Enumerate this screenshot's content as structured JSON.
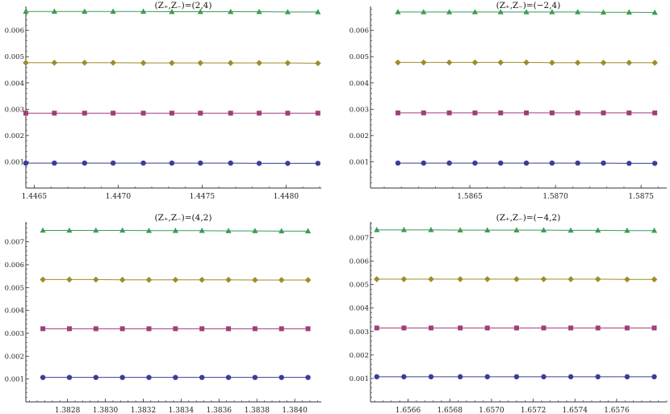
{
  "colors": {
    "series1": "#3b3d98",
    "series2": "#a03f78",
    "series3": "#9e8c2b",
    "series4": "#3a9c53",
    "axis": "#333333"
  },
  "chart_data": [
    {
      "type": "line",
      "title": "(Z₊,Z₋)=(2,4)",
      "xlim": [
        1.44645,
        1.44821
      ],
      "ylim": [
        0.0,
        0.00685
      ],
      "xticks": [
        "1.4465",
        "1.4470",
        "1.4475",
        "1.4480"
      ],
      "xtick_values": [
        1.4465,
        1.447,
        1.4475,
        1.448
      ],
      "yticks": [
        "0.001",
        "0.002",
        "0.003",
        "0.004",
        "0.005",
        "0.006"
      ],
      "ytick_values": [
        0.001,
        0.002,
        0.003,
        0.004,
        0.005,
        0.006
      ],
      "x": [
        1.44645,
        1.44662,
        1.4468,
        1.44697,
        1.44715,
        1.44732,
        1.44749,
        1.44767,
        1.44784,
        1.44801,
        1.44819
      ],
      "series": [
        {
          "marker": "circle",
          "values": [
            0.00095,
            0.00095,
            0.00095,
            0.00095,
            0.00095,
            0.00095,
            0.00095,
            0.00095,
            0.00094,
            0.00094,
            0.00094
          ]
        },
        {
          "marker": "square",
          "values": [
            0.00285,
            0.00285,
            0.00285,
            0.00285,
            0.00285,
            0.00285,
            0.00285,
            0.00285,
            0.00285,
            0.00285,
            0.00285
          ]
        },
        {
          "marker": "diamond",
          "values": [
            0.00477,
            0.00477,
            0.00477,
            0.00477,
            0.00476,
            0.00476,
            0.00476,
            0.00476,
            0.00476,
            0.00476,
            0.00475
          ]
        },
        {
          "marker": "triangle",
          "values": [
            0.00672,
            0.00672,
            0.00672,
            0.00672,
            0.00672,
            0.00671,
            0.00671,
            0.00671,
            0.00671,
            0.0067,
            0.0067
          ]
        }
      ]
    },
    {
      "type": "line",
      "title": "(Z₊,Z₋)=(−2,4)",
      "xlim": [
        1.58592,
        1.58765
      ],
      "ylim": [
        0.0,
        0.00685
      ],
      "xticks": [
        "1.5865",
        "1.5870",
        "1.5875"
      ],
      "xtick_values": [
        1.5865,
        1.587,
        1.5875
      ],
      "yticks": [
        "0.001",
        "0.002",
        "0.003",
        "0.004",
        "0.005",
        "0.006"
      ],
      "ytick_values": [
        0.001,
        0.002,
        0.003,
        0.004,
        0.005,
        0.006
      ],
      "x": [
        1.58608,
        1.58623,
        1.58638,
        1.58653,
        1.58668,
        1.58683,
        1.58698,
        1.58713,
        1.58728,
        1.58743,
        1.58758
      ],
      "series": [
        {
          "marker": "circle",
          "values": [
            0.00095,
            0.00095,
            0.00095,
            0.00095,
            0.00095,
            0.00095,
            0.00095,
            0.00095,
            0.00095,
            0.00094,
            0.00094
          ]
        },
        {
          "marker": "square",
          "values": [
            0.00286,
            0.00286,
            0.00286,
            0.00286,
            0.00286,
            0.00286,
            0.00286,
            0.00286,
            0.00286,
            0.00286,
            0.00286
          ]
        },
        {
          "marker": "diamond",
          "values": [
            0.00478,
            0.00478,
            0.00478,
            0.00478,
            0.00478,
            0.00478,
            0.00477,
            0.00477,
            0.00477,
            0.00477,
            0.00477
          ]
        },
        {
          "marker": "triangle",
          "values": [
            0.0067,
            0.0067,
            0.0067,
            0.0067,
            0.0067,
            0.0067,
            0.0067,
            0.0067,
            0.00669,
            0.00669,
            0.00668
          ]
        }
      ]
    },
    {
      "type": "line",
      "title": "(Z₊,Z₋)=(4,2)",
      "xlim": [
        1.38258,
        1.38414
      ],
      "ylim": [
        0.0,
        0.0078
      ],
      "xticks": [
        "1.3828",
        "1.3830",
        "1.3832",
        "1.3834",
        "1.3836",
        "1.3838",
        "1.3840"
      ],
      "xtick_values": [
        1.3828,
        1.383,
        1.3832,
        1.3834,
        1.3836,
        1.3838,
        1.384
      ],
      "yticks": [
        "0.001",
        "0.002",
        "0.003",
        "0.004",
        "0.005",
        "0.006",
        "0.007"
      ],
      "ytick_values": [
        0.001,
        0.002,
        0.003,
        0.004,
        0.005,
        0.006,
        0.007
      ],
      "x": [
        1.38267,
        1.38281,
        1.38295,
        1.38309,
        1.38323,
        1.38337,
        1.38351,
        1.38365,
        1.38379,
        1.38393,
        1.38407
      ],
      "series": [
        {
          "marker": "circle",
          "values": [
            0.00107,
            0.00107,
            0.00107,
            0.00107,
            0.00107,
            0.00107,
            0.00107,
            0.00107,
            0.00107,
            0.00107,
            0.00107
          ]
        },
        {
          "marker": "square",
          "values": [
            0.0032,
            0.0032,
            0.0032,
            0.0032,
            0.0032,
            0.0032,
            0.0032,
            0.0032,
            0.0032,
            0.0032,
            0.0032
          ]
        },
        {
          "marker": "diamond",
          "values": [
            0.00535,
            0.00535,
            0.00535,
            0.00534,
            0.00534,
            0.00534,
            0.00534,
            0.00534,
            0.00533,
            0.00533,
            0.00533
          ]
        },
        {
          "marker": "triangle",
          "values": [
            0.0075,
            0.0075,
            0.0075,
            0.0075,
            0.00749,
            0.00749,
            0.00749,
            0.00748,
            0.00748,
            0.00747,
            0.00747
          ]
        }
      ]
    },
    {
      "type": "line",
      "title": "(Z₊,Z₋)=(−4,2)",
      "xlim": [
        1.65642,
        1.65784
      ],
      "ylim": [
        0.0,
        0.0076
      ],
      "xticks": [
        "1.6566",
        "1.6568",
        "1.6570",
        "1.6572",
        "1.6574",
        "1.6576"
      ],
      "xtick_values": [
        1.6566,
        1.6568,
        1.657,
        1.6572,
        1.6574,
        1.6576
      ],
      "yticks": [
        "0.001",
        "0.002",
        "0.003",
        "0.004",
        "0.005",
        "0.006",
        "0.007"
      ],
      "ytick_values": [
        0.001,
        0.002,
        0.003,
        0.004,
        0.005,
        0.006,
        0.007
      ],
      "x": [
        1.65645,
        1.65658,
        1.65671,
        1.65685,
        1.65698,
        1.65712,
        1.65725,
        1.65738,
        1.65751,
        1.65765,
        1.65778
      ],
      "series": [
        {
          "marker": "circle",
          "values": [
            0.00107,
            0.00107,
            0.00107,
            0.00107,
            0.00107,
            0.00107,
            0.00107,
            0.00107,
            0.00107,
            0.00107,
            0.00107
          ]
        },
        {
          "marker": "square",
          "values": [
            0.00315,
            0.00315,
            0.00315,
            0.00315,
            0.00315,
            0.00315,
            0.00315,
            0.00315,
            0.00315,
            0.00315,
            0.00315
          ]
        },
        {
          "marker": "diamond",
          "values": [
            0.00523,
            0.00523,
            0.00523,
            0.00523,
            0.00523,
            0.00523,
            0.00523,
            0.00523,
            0.00523,
            0.00522,
            0.00522
          ]
        },
        {
          "marker": "triangle",
          "values": [
            0.00733,
            0.00733,
            0.00733,
            0.00732,
            0.00732,
            0.00732,
            0.00732,
            0.00731,
            0.00731,
            0.0073,
            0.0073
          ]
        }
      ]
    }
  ]
}
